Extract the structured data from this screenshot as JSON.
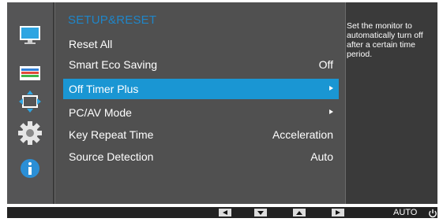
{
  "sidebar": {
    "icons": [
      {
        "name": "picture-icon"
      },
      {
        "name": "color-icon"
      },
      {
        "name": "size-position-icon"
      },
      {
        "name": "setup-reset-icon"
      },
      {
        "name": "information-icon"
      }
    ]
  },
  "menu": {
    "title": "SETUP&RESET",
    "items": [
      {
        "label": "Reset All",
        "value": ""
      },
      {
        "label": "Smart Eco Saving",
        "value": "Off"
      },
      {
        "label": "Off Timer Plus",
        "value": "",
        "selected": true
      },
      {
        "label": "PC/AV Mode",
        "value": ""
      },
      {
        "label": "Key Repeat Time",
        "value": "Acceleration"
      },
      {
        "label": "Source Detection",
        "value": "Auto"
      }
    ]
  },
  "help": {
    "text": "Set the monitor to automatically turn off after a certain time period."
  },
  "bottom_bar": {
    "auto_label": "AUTO"
  },
  "colors": {
    "accent": "#1a96d3",
    "title": "#1f86c9",
    "panel": "#505050",
    "background": "#3a3a3a"
  }
}
